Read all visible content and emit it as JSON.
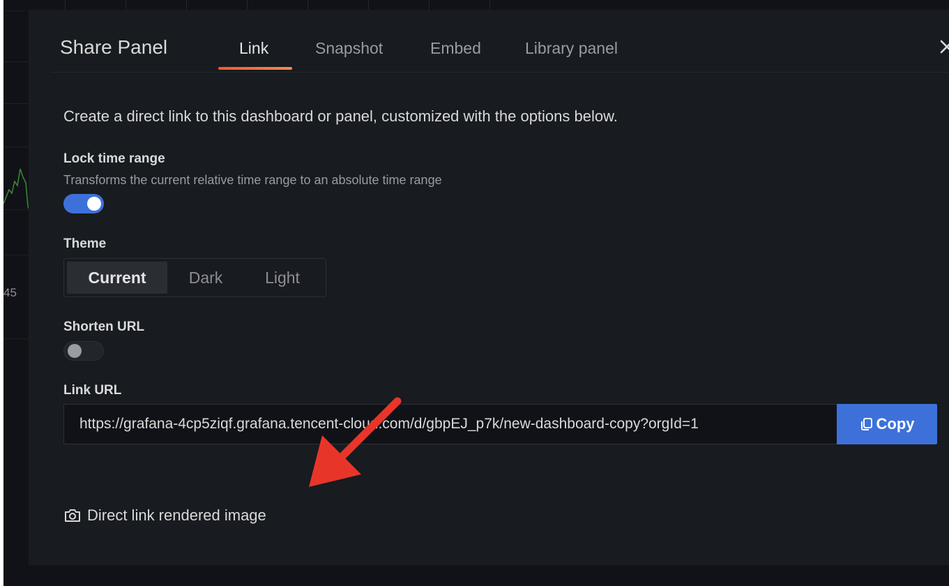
{
  "background": {
    "axis_label": "45"
  },
  "modal": {
    "title": "Share Panel",
    "tabs": [
      {
        "label": "Link",
        "active": true
      },
      {
        "label": "Snapshot",
        "active": false
      },
      {
        "label": "Embed",
        "active": false
      },
      {
        "label": "Library panel",
        "active": false
      }
    ],
    "close_icon": "close-icon"
  },
  "link_tab": {
    "intro": "Create a direct link to this dashboard or panel, customized with the options below.",
    "lock_time_range": {
      "label": "Lock time range",
      "description": "Transforms the current relative time range to an absolute time range",
      "enabled": true
    },
    "theme": {
      "label": "Theme",
      "options": [
        "Current",
        "Dark",
        "Light"
      ],
      "selected": "Current"
    },
    "shorten_url": {
      "label": "Shorten URL",
      "enabled": false
    },
    "link_url": {
      "label": "Link URL",
      "value": "https://grafana-4cp5ziqf.grafana.tencent-cloud.com/d/gbpEJ_p7k/new-dashboard-copy?orgId=1",
      "copy_label": "Copy",
      "copy_icon": "copy-icon"
    },
    "direct_link": {
      "label": "Direct link rendered image",
      "icon": "camera-icon"
    }
  },
  "colors": {
    "accent_blue": "#3d71d9",
    "tab_underline": "#f25a2e",
    "annotation_arrow": "#e8352a",
    "modal_bg": "#181b1f",
    "page_bg": "#111217"
  }
}
